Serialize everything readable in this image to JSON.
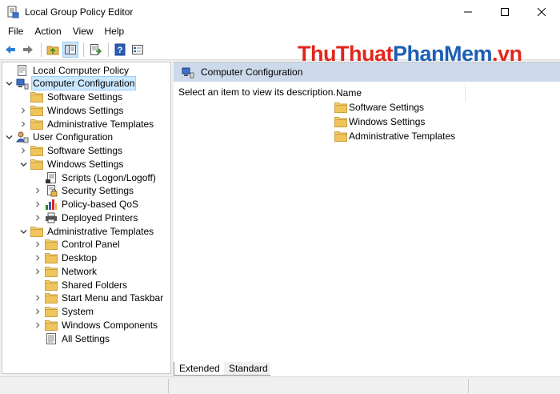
{
  "window": {
    "title": "Local Group Policy Editor",
    "icon": "policy-editor-icon",
    "controls": [
      "minimize",
      "maximize",
      "close"
    ]
  },
  "menu": [
    "File",
    "Action",
    "View",
    "Help"
  ],
  "toolbar": {
    "buttons": [
      "back-arrow-icon",
      "forward-arrow-icon",
      "up-folder-icon",
      "show-hide-tree-icon",
      "export-list-icon",
      "help-icon",
      "properties-icon"
    ]
  },
  "watermark": {
    "part1": "ThuThuat",
    "part2": "PhanMem",
    "part3": ".vn"
  },
  "tree": [
    {
      "label": "Local Computer Policy",
      "level": 0,
      "expanded": null,
      "icon": "policy-document-icon"
    },
    {
      "label": "Computer Configuration",
      "level": 0,
      "expanded": true,
      "icon": "computer-icon",
      "selected": true
    },
    {
      "label": "Software Settings",
      "level": 1,
      "expanded": null,
      "icon": "folder-icon"
    },
    {
      "label": "Windows Settings",
      "level": 1,
      "expanded": false,
      "icon": "folder-icon"
    },
    {
      "label": "Administrative Templates",
      "level": 1,
      "expanded": false,
      "icon": "folder-icon"
    },
    {
      "label": "User Configuration",
      "level": 0,
      "expanded": true,
      "icon": "user-icon"
    },
    {
      "label": "Software Settings",
      "level": 1,
      "expanded": false,
      "icon": "folder-icon"
    },
    {
      "label": "Windows Settings",
      "level": 1,
      "expanded": true,
      "icon": "folder-icon"
    },
    {
      "label": "Scripts (Logon/Logoff)",
      "level": 2,
      "expanded": null,
      "icon": "scripts-icon"
    },
    {
      "label": "Security Settings",
      "level": 2,
      "expanded": false,
      "icon": "security-icon"
    },
    {
      "label": "Policy-based QoS",
      "level": 2,
      "expanded": false,
      "icon": "qos-chart-icon"
    },
    {
      "label": "Deployed Printers",
      "level": 2,
      "expanded": false,
      "icon": "printer-icon"
    },
    {
      "label": "Administrative Templates",
      "level": 1,
      "expanded": true,
      "icon": "folder-icon"
    },
    {
      "label": "Control Panel",
      "level": 2,
      "expanded": false,
      "icon": "folder-icon"
    },
    {
      "label": "Desktop",
      "level": 2,
      "expanded": false,
      "icon": "folder-icon"
    },
    {
      "label": "Network",
      "level": 2,
      "expanded": false,
      "icon": "folder-icon"
    },
    {
      "label": "Shared Folders",
      "level": 2,
      "expanded": null,
      "icon": "folder-icon"
    },
    {
      "label": "Start Menu and Taskbar",
      "level": 2,
      "expanded": false,
      "icon": "folder-icon"
    },
    {
      "label": "System",
      "level": 2,
      "expanded": false,
      "icon": "folder-icon"
    },
    {
      "label": "Windows Components",
      "level": 2,
      "expanded": false,
      "icon": "folder-icon"
    },
    {
      "label": "All Settings",
      "level": 2,
      "expanded": null,
      "icon": "all-settings-icon"
    }
  ],
  "content": {
    "header_title": "Computer Configuration",
    "description": "Select an item to view its description.",
    "column_name": "Name",
    "items": [
      "Software Settings",
      "Windows Settings",
      "Administrative Templates"
    ]
  },
  "tabs": {
    "extended": "Extended",
    "standard": "Standard",
    "active": "Extended"
  },
  "colors": {
    "header_bg": "#ccd9ea",
    "selection_bg": "#cce8ff",
    "folder": "#e8b94a",
    "watermark_red": "#e1261c",
    "watermark_blue": "#1c5fb4"
  }
}
